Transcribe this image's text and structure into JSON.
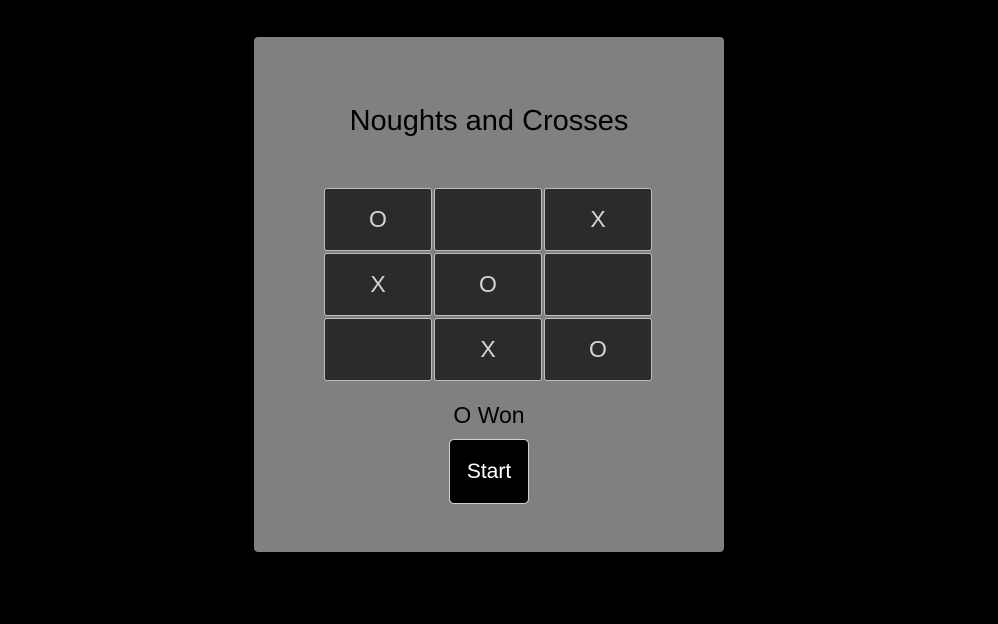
{
  "game": {
    "title": "Noughts and Crosses",
    "status": "O Won",
    "start_label": "Start"
  },
  "board": {
    "cells": [
      "O",
      "",
      "X",
      "X",
      "O",
      "",
      "",
      "X",
      "O"
    ]
  },
  "colors": {
    "background": "#000000",
    "panel": "#808080",
    "cell": "#2b2b2b",
    "cell_text": "#d4d4d4",
    "button": "#000000"
  }
}
